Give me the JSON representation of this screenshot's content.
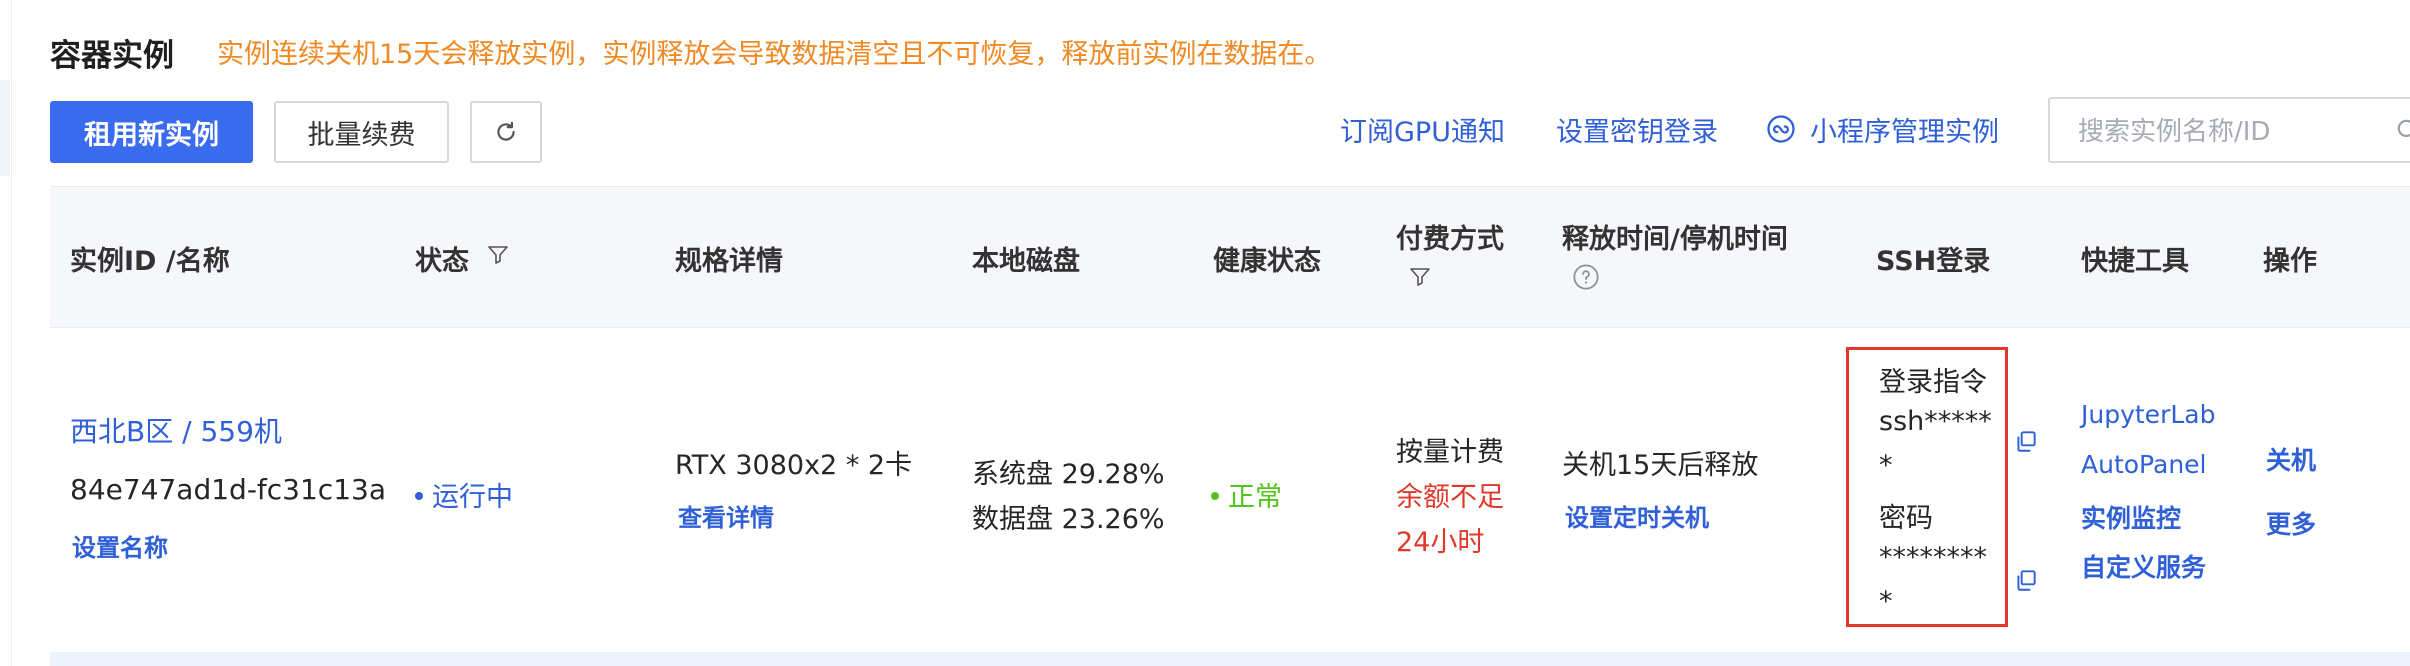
{
  "page": {
    "title": "容器实例",
    "notice": "实例连续关机15天会释放实例，实例释放会导致数据清空且不可恢复，释放前实例在数据在。"
  },
  "toolbar": {
    "rent_label": "租用新实例",
    "renew_label": "批量续费",
    "refresh_icon": "refresh-icon",
    "subscribe_label": "订阅GPU通知",
    "ssh_key_label": "设置密钥登录",
    "miniapp_label": "小程序管理实例",
    "search_placeholder": "搜索实例名称/ID"
  },
  "table": {
    "headers": {
      "id": "实例ID /名称",
      "status": "状态",
      "spec": "规格详情",
      "disk": "本地磁盘",
      "health": "健康状态",
      "billing_line1": "付费方式",
      "release": "释放时间/停机时间",
      "ssh": "SSH登录",
      "tools": "快捷工具",
      "actions": "操作"
    },
    "rows": [
      {
        "name": "西北B区 / 559机",
        "id": "84e747ad1d-fc31c13a",
        "set_name": "设置名称",
        "status": "运行中",
        "spec": "RTX 3080x2 * 2卡",
        "spec_detail": "查看详情",
        "disk_system": "系统盘 29.28%",
        "disk_data": "数据盘 23.26%",
        "health": "正常",
        "billing": "按量计费",
        "billing_warn_1": "余额不足",
        "billing_warn_2": "24小时",
        "release": "关机15天后释放",
        "release_action": "设置定时关机",
        "ssh_cmd_label": "登录指令",
        "ssh_cmd_1": "ssh*****",
        "ssh_cmd_2": "*",
        "ssh_pwd_label": "密码",
        "ssh_pwd_1": "********",
        "ssh_pwd_2": "*",
        "tools": [
          "JupyterLab",
          "AutoPanel",
          "实例监控",
          "自定义服务"
        ],
        "action_shutdown": "关机",
        "action_more": "更多"
      }
    ]
  },
  "colors": {
    "primary": "#3b6cf0",
    "link": "#2f60d8",
    "notice": "#f08a24",
    "warn": "#e0392b",
    "healthy": "#52c41a"
  }
}
